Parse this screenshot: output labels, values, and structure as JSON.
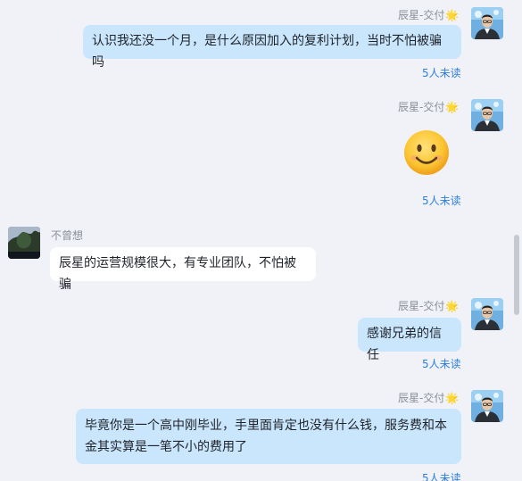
{
  "messages": [
    {
      "sender": "辰星-交付",
      "badge": "🌟",
      "text": "认识我还没一个月，是什么原因加入的复利计划，当时不怕被骗吗",
      "status": "5人未读"
    },
    {
      "sender": "辰星-交付",
      "badge": "🌟",
      "emoji": "smiley-face",
      "status": "5人未读"
    },
    {
      "sender": "不曾想",
      "text": "辰星的运营规模很大，有专业团队，不怕被骗"
    },
    {
      "sender": "辰星-交付",
      "badge": "🌟",
      "text": "感谢兄弟的信任",
      "status": "5人未读"
    },
    {
      "sender": "辰星-交付",
      "badge": "🌟",
      "text_line1": "毕竟你是一个高中刚毕业，手里面肯定也没有什么钱，服务费和本",
      "text_line2": "金其实算是一笔不小的费用了",
      "status": "5人未读"
    }
  ],
  "colors": {
    "background": "#f0f2f7",
    "self_bubble": "#c9e6fd",
    "other_bubble": "#ffffff",
    "unread_text": "#2e7fde",
    "name_text": "#8a8f99"
  }
}
